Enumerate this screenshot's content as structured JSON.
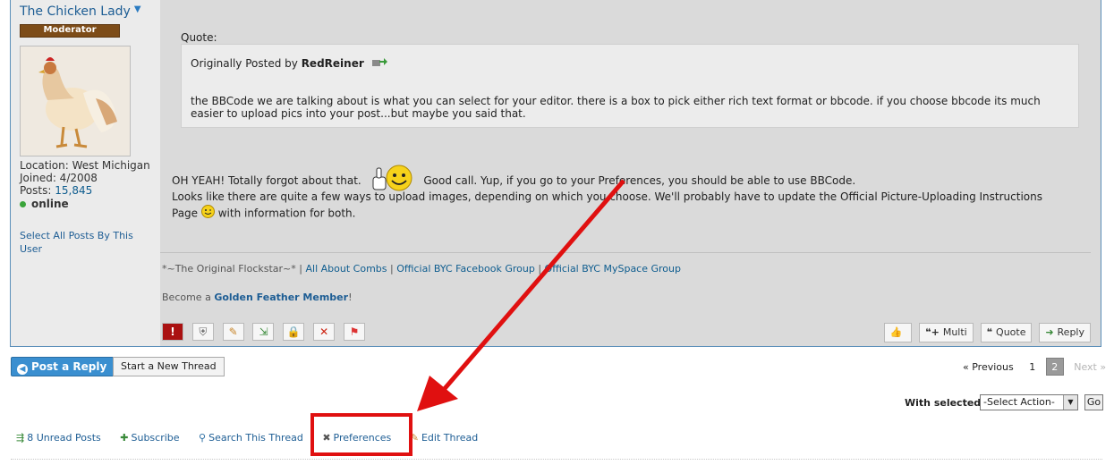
{
  "user": {
    "name": "The Chicken Lady",
    "role": "Moderator",
    "location": "Location: West Michigan",
    "joined": "Joined: 4/2008",
    "posts_label": "Posts:",
    "posts_count": "15,845",
    "status": "online",
    "select_all": "Select All Posts By This User"
  },
  "quote": {
    "label": "Quote:",
    "by_prefix": "Originally Posted by",
    "author": "RedReiner",
    "text": "the BBCode we are talking about is what you can select for your editor. there is a box to pick either rich text format or bbcode. if you choose bbcode its much easier to upload pics into your post...but maybe you said that."
  },
  "message": {
    "line1_a": "OH YEAH!  Totally forgot about that.",
    "line1_b": "Good call.  Yup, if you go to your Preferences, you should be able to use BBCode.",
    "line2_a": "Looks like there are quite a few ways to upload images, depending on which you choose.  We'll probably have to update the Official Picture-Uploading Instructions Page",
    "line2_b": "with information for both."
  },
  "signature": {
    "flockstar": "*~The Original Flockstar~*",
    "sep": "|",
    "link1": "All About Combs",
    "link2": "Official BYC Facebook Group",
    "link3": "Official BYC MySpace Group",
    "become_prefix": "Become a",
    "become_link": "Golden Feather Member",
    "become_suffix": "!"
  },
  "actions": {
    "multi": "Multi",
    "quote": "Quote",
    "reply": "Reply"
  },
  "buttons": {
    "post_reply": "Post a Reply",
    "new_thread": "Start a New Thread"
  },
  "pager": {
    "prev": "« Previous",
    "page1": "1",
    "page2": "2",
    "next": "Next »"
  },
  "bulk": {
    "label": "With selected:",
    "selected": "-Select Action-",
    "go": "Go"
  },
  "tools": {
    "unread": "8 Unread Posts",
    "subscribe": "Subscribe",
    "search": "Search This Thread",
    "preferences": "Preferences",
    "edit": "Edit Thread"
  },
  "colors": {
    "annotation": "#e01010",
    "link": "#1d5d94",
    "badge": "#7d4c18",
    "post_reply": "#3a8fd0"
  }
}
